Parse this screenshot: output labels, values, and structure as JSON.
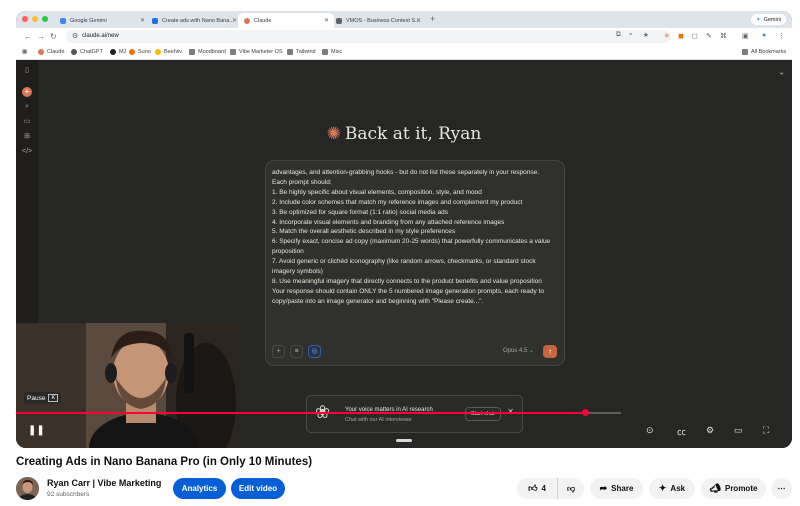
{
  "browser": {
    "tabs": [
      {
        "label": "Google Gemini",
        "color": "#4285f4",
        "active": false
      },
      {
        "label": "Create ads with Nano Bana...",
        "color": "#1a73e8",
        "active": false
      },
      {
        "label": "Claude",
        "color": "#d97757",
        "active": true
      },
      {
        "label": "VMOS - Business Context S...",
        "color": "#5f6368",
        "active": false
      }
    ],
    "gemini_button": "Gemini",
    "url": "claude.ai/new",
    "bookmarks": [
      "Claude",
      "ChatGPT",
      "MJ",
      "Suno",
      "Beehiiv",
      "Moodboard",
      "Vibe Marketer OS",
      "Tailwind",
      "Misc"
    ],
    "all_bookmarks": "All Bookmarks"
  },
  "claude": {
    "greeting": "Back at it, Ryan",
    "prompt_lines": [
      "advantages, and attention-grabbing hooks - but do not list these separately in your response.",
      "Each prompt should:",
      "1. Be highly specific about visual elements, composition, style, and mood",
      "2. Include color schemes that match my reference images and complement my product",
      "3. Be optimized for square format (1:1 ratio) social media ads",
      "4. Incorporate visual elements and branding from any attached reference images",
      "5. Match the overall aesthetic described in my style preferences",
      "6. Specify exact, concise ad copy (maximum 20-25 words) that powerfully communicates a value proposition",
      "7. Avoid generic or clichéd iconography (like random arrows, checkmarks, or standard stock imagery symbols)",
      "8. Use meaningful imagery that directly connects to the product benefits and value proposition",
      "Your response should contain ONLY the 5 numbered image generation prompts, each ready to copy/paste into an image generator and beginning with \"Please create...\"."
    ],
    "model": "Opus 4.5",
    "voice_banner": {
      "title": "Your voice matters in AI research",
      "subtitle": "Chat with our AI interviewer",
      "button": "Start chat"
    }
  },
  "player": {
    "pause_label": "Pause",
    "pause_key": "K",
    "progress": 0.94
  },
  "video": {
    "title": "Creating Ads in Nano Banana Pro (in Only 10 Minutes)",
    "channel": "Ryan Carr | Vibe Marketing",
    "subscribers": "92 subscribers",
    "analytics": "Analytics",
    "edit_video": "Edit video",
    "likes": "4",
    "share": "Share",
    "ask": "Ask",
    "promote": "Promote"
  },
  "colors": {
    "claude_accent": "#d97757",
    "youtube_red": "#ff0033",
    "youtube_blue": "#065fd4"
  }
}
